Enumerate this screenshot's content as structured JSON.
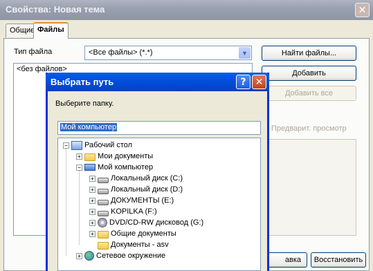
{
  "window": {
    "title": "Свойства: Новая тема"
  },
  "tabs": [
    {
      "label": "Общие"
    },
    {
      "label": "Файлы"
    }
  ],
  "file_type": {
    "label": "Тип файла",
    "value": "<Все файлы> (*.*)"
  },
  "buttons": {
    "find": "Найти файлы...",
    "add": "Добавить",
    "add_all": "Добавить все",
    "preview": "Предварит. просмотр",
    "apply_partial": "авка",
    "restore": "Восстановить"
  },
  "file_list": {
    "empty": "<без файлов>"
  },
  "dialog": {
    "title": "Выбрать путь",
    "prompt": "Выберите папку.",
    "path_value": "Мой компьютер",
    "tree": [
      {
        "label": "Рабочий стол",
        "icon": "desktop-icon"
      },
      {
        "label": "Мои документы",
        "icon": "folder-icon"
      },
      {
        "label": "Мой компьютер",
        "icon": "computer-icon"
      },
      {
        "label": "Локальный диск (C:)",
        "icon": "drive-icon"
      },
      {
        "label": "Локальный диск (D:)",
        "icon": "drive-icon"
      },
      {
        "label": "ДОКУМЕНТЫ (E:)",
        "icon": "drive-icon"
      },
      {
        "label": "KOPILKA (F:)",
        "icon": "drive-icon"
      },
      {
        "label": "DVD/CD-RW дисковод (G:)",
        "icon": "cd-drive-icon"
      },
      {
        "label": "Общие документы",
        "icon": "folder-icon"
      },
      {
        "label": "Документы - asv",
        "icon": "folder-icon"
      },
      {
        "label": "Сетевое окружение",
        "icon": "network-icon"
      }
    ]
  }
}
